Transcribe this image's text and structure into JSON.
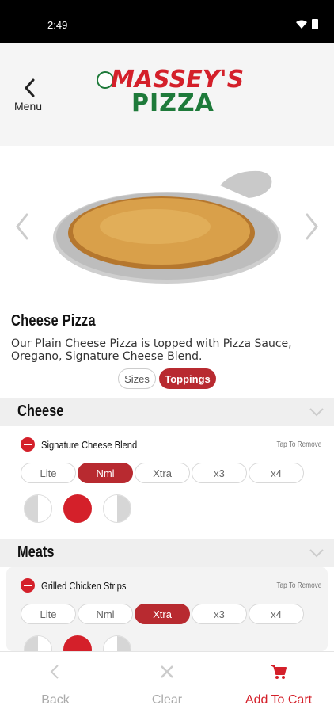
{
  "status": {
    "time": "2:49"
  },
  "header": {
    "back_label": "Menu",
    "logo_line1": "MASSEY'S",
    "logo_line2": "PIZZA"
  },
  "product": {
    "title": "Cheese Pizza",
    "description": "Our Plain Cheese Pizza is topped with Pizza Sauce, Oregano, Signature Cheese Blend."
  },
  "tabs": [
    {
      "label": "Sizes",
      "active": false
    },
    {
      "label": "Toppings",
      "active": true
    }
  ],
  "sections": [
    {
      "title": "Cheese",
      "items": [
        {
          "name": "Signature Cheese Blend",
          "hint": "Tap To Remove",
          "amounts": [
            "Lite",
            "Nml",
            "Xtra",
            "x3",
            "x4"
          ],
          "selected_amount": "Nml",
          "portion_selected": "whole"
        }
      ]
    },
    {
      "title": "Meats",
      "items": [
        {
          "name": "Grilled Chicken Strips",
          "hint": "Tap To Remove",
          "amounts": [
            "Lite",
            "Nml",
            "Xtra",
            "x3",
            "x4"
          ],
          "selected_amount": "Xtra",
          "portion_selected": "whole"
        }
      ]
    }
  ],
  "bottom_bar": {
    "back_label": "Back",
    "clear_label": "Clear",
    "cart_label": "Add To Cart"
  },
  "colors": {
    "brand_red": "#d4202a",
    "active_pill": "#b82a30",
    "brand_green": "#1e7a3a"
  }
}
